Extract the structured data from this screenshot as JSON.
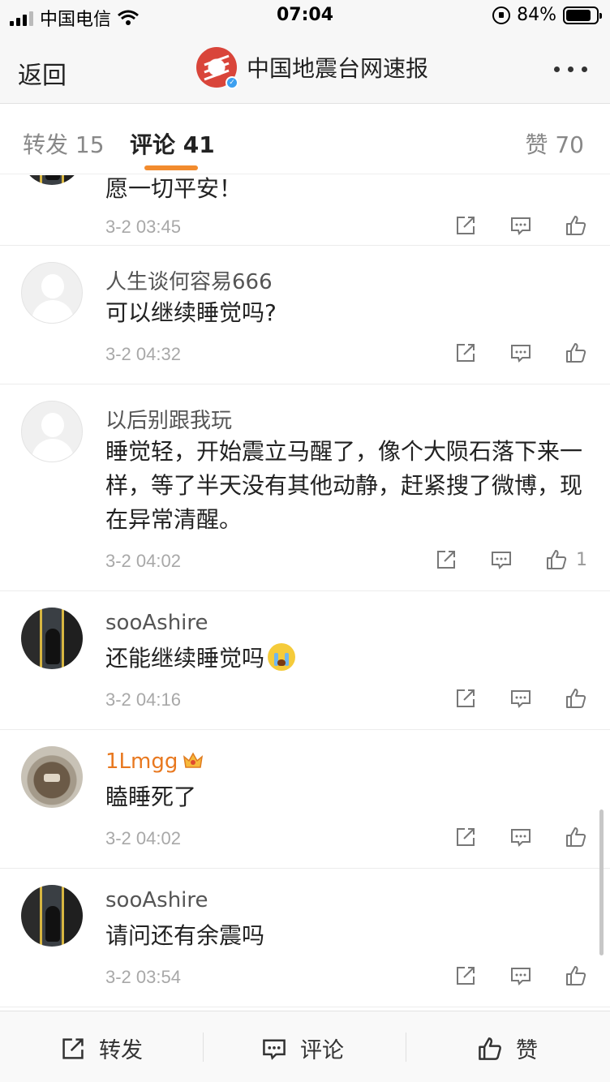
{
  "status_bar": {
    "carrier": "中国电信",
    "time": "07:04",
    "battery": "84%",
    "battery_level": 0.84
  },
  "nav": {
    "back_label": "返回",
    "title": "中国地震台网速报"
  },
  "tabs": {
    "repost": "转发 15",
    "comments": "评论 41",
    "likes": "赞 70"
  },
  "comments": [
    {
      "username": "",
      "text": "愿一切平安！",
      "time": "3-2 03:45",
      "likes": ""
    },
    {
      "username": "人生谈何容易666",
      "text": "可以继续睡觉吗?",
      "time": "3-2 04:32",
      "likes": ""
    },
    {
      "username": "以后别跟我玩",
      "text": "睡觉轻，开始震立马醒了，像个大陨石落下来一样，等了半天没有其他动静，赶紧搜了微博，现在异常清醒。",
      "time": "3-2 04:02",
      "likes": "1"
    },
    {
      "username": "sooAshire",
      "text": "还能继续睡觉吗",
      "time": "3-2 04:16",
      "likes": ""
    },
    {
      "username": "1Lmgg",
      "text": "瞌睡死了",
      "time": "3-2 04:02",
      "likes": ""
    },
    {
      "username": "sooAshire",
      "text": "请问还有余震吗",
      "time": "3-2 03:54",
      "likes": ""
    }
  ],
  "bottom_bar": {
    "repost": "转发",
    "comment": "评论",
    "like": "赞"
  },
  "colors": {
    "accent": "#f28b2e",
    "vip_name": "#e8781f",
    "logo_red": "#d9453a"
  }
}
